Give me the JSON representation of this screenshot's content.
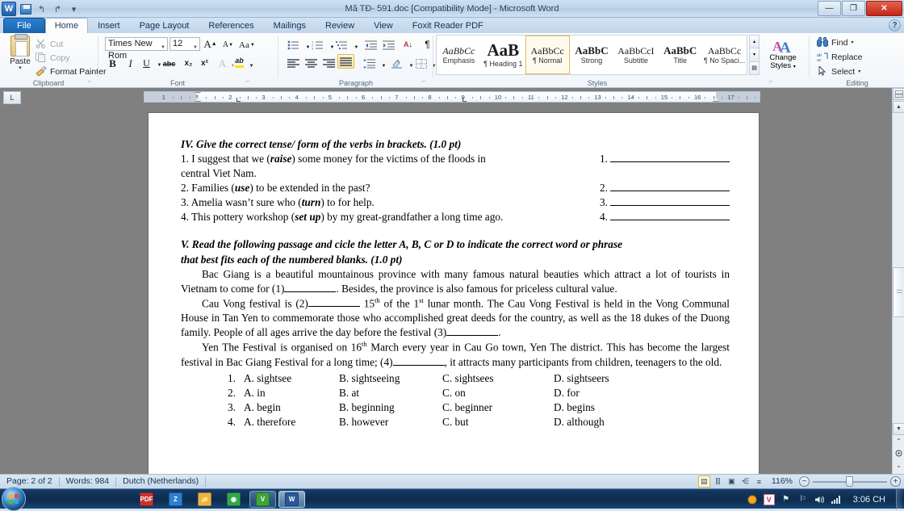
{
  "window": {
    "title": "Mã TĐ- 591.doc [Compatibility Mode]  -  Microsoft Word",
    "minimize": "—",
    "maximize": "❐",
    "close": "✕",
    "help": "?"
  },
  "quick_access": {
    "app_icon_label": "W",
    "save_label": "",
    "undo_label": "↰",
    "redo_label": "↱",
    "customize_label": "▾"
  },
  "ribbon": {
    "tabs": [
      {
        "label": "File",
        "state": "file"
      },
      {
        "label": "Home",
        "state": "active"
      },
      {
        "label": "Insert",
        "state": ""
      },
      {
        "label": "Page Layout",
        "state": ""
      },
      {
        "label": "References",
        "state": ""
      },
      {
        "label": "Mailings",
        "state": ""
      },
      {
        "label": "Review",
        "state": ""
      },
      {
        "label": "View",
        "state": ""
      },
      {
        "label": "Foxit Reader PDF",
        "state": ""
      }
    ],
    "clipboard": {
      "group_label": "Clipboard",
      "paste_label": "Paste",
      "paste_arrow": "▾",
      "cut_label": "Cut",
      "copy_label": "Copy",
      "format_painter_label": "Format Painter"
    },
    "font": {
      "group_label": "Font",
      "font_name": "Times New Rom",
      "font_size": "12",
      "grow_font": "A",
      "shrink_font": "A",
      "change_case": "Aa",
      "clear_formatting": "⌫",
      "bold": "B",
      "italic": "I",
      "underline": "U",
      "strikethrough": "abc",
      "subscript": "x₂",
      "superscript": "x²",
      "text_effects": "A",
      "highlight": "ab",
      "font_color": "A"
    },
    "paragraph": {
      "group_label": "Paragraph",
      "bullets": "≔",
      "numbering": "≔",
      "multilevel": "≔",
      "decrease_indent": "⇤",
      "increase_indent": "⇥",
      "sort": "A↓",
      "show_marks": "¶",
      "align_left": "≡",
      "align_center": "≡",
      "align_right": "≡",
      "justify": "≡",
      "line_spacing": "↕",
      "shading": "▨",
      "borders": "⊞"
    },
    "styles": {
      "group_label": "Styles",
      "items": [
        {
          "preview": "AaBbCc",
          "name": "Emphasis",
          "selected": false,
          "style": "italic"
        },
        {
          "preview": "AaB",
          "name": "¶ Heading 1",
          "selected": false,
          "style": "h1"
        },
        {
          "preview": "AaBbCc",
          "name": "¶ Normal",
          "selected": true,
          "style": "normal"
        },
        {
          "preview": "AaBbC",
          "name": "Strong",
          "selected": false,
          "style": "bold"
        },
        {
          "preview": "AaBbCcI",
          "name": "Subtitle",
          "selected": false,
          "style": "normal"
        },
        {
          "preview": "AaBbC",
          "name": "Title",
          "selected": false,
          "style": "bold"
        },
        {
          "preview": "AaBbCc",
          "name": "¶ No Spaci...",
          "selected": false,
          "style": "normal"
        }
      ],
      "change_styles_label": "Change\nStyles",
      "change_styles_line1": "Change",
      "change_styles_line2": "Styles",
      "change_styles_arrow": "▾",
      "gallery_up": "▴",
      "gallery_down": "▾",
      "gallery_more": "▤"
    },
    "editing": {
      "group_label": "Editing",
      "find_label": "Find",
      "find_arrow": "▾",
      "replace_label": "Replace",
      "select_label": "Select",
      "select_arrow": "▾"
    }
  },
  "ruler": {
    "corner_label": "L",
    "numbers": [
      "1",
      "1",
      "1",
      "2",
      "3",
      "4",
      "5",
      "6",
      "7",
      "8",
      "9",
      "10",
      "11",
      "12",
      "13",
      "14",
      "15",
      "16",
      "17"
    ]
  },
  "document": {
    "section4": {
      "heading": "IV. Give the correct tense/ form of the verbs in brackets. (1.0 pt)",
      "items": [
        {
          "number": "1.",
          "text_before": "1. I suggest that we (",
          "verb": "raise",
          "text_after": ") some money for the victims of the floods in",
          "line2": "central Viet Nam.",
          "answer_number": "1."
        },
        {
          "number": "2.",
          "text_before": "2. Families (",
          "verb": "use",
          "text_after": ") to be extended in the past?",
          "answer_number": "2."
        },
        {
          "number": "3.",
          "text_before": "3. Amelia wasn’t sure who (",
          "verb": "turn",
          "text_after": ") to for help.",
          "answer_number": "3."
        },
        {
          "number": "4.",
          "text_before": "4. This pottery workshop (",
          "verb": "set up",
          "text_after": ") by my great-grandfather a long time ago.",
          "answer_number": "4."
        }
      ]
    },
    "section5": {
      "heading_line1": "V. Read the following passage and cicle the letter A, B, C or D to indicate the correct word or phrase",
      "heading_line2": "that best fits each of the numbered blanks. (1.0 pt)",
      "para1_a": "Bac Giang is a beautiful mountainous province with many famous natural beauties which attract a lot of tourists in Vietnam to come for (1)",
      "para1_b": ". Besides, the province is also famous for priceless cultural value.",
      "para2_a": "Cau Vong festival is (2)",
      "para2_b": " 15",
      "para2_sup1": "th",
      "para2_c": " of the 1",
      "para2_sup2": "st",
      "para2_d": " lunar month. The Cau Vong Festival is held in the Vong Communal House in Tan Yen to commemorate those who accomplished great deeds for the country, as well as the 18 dukes of the Duong family. People of all ages arrive the day before the festival (3)",
      "para2_e": ".",
      "para3_a": "Yen The Festival is organised on 16",
      "para3_sup": "th",
      "para3_b": " March every year in Cau Go town, Yen The district. This has become the largest festival in Bac Giang Festival for a long time; (4)",
      "para3_c": ", it attracts many participants from children, teenagers to the old.",
      "options": [
        {
          "n": "1.",
          "a": "A. sightsee",
          "b": "B. sightseeing",
          "c": "C. sightsees",
          "d": "D. sightseers"
        },
        {
          "n": "2.",
          "a": "A. in",
          "b": "B. at",
          "c": "C. on",
          "d": "D. for"
        },
        {
          "n": "3.",
          "a": "A. begin",
          "b": "B. beginning",
          "c": "C. beginner",
          "d": "D. begins"
        },
        {
          "n": "4.",
          "a": "A. therefore",
          "b": "B. however",
          "c": "C. but",
          "d": "D. although"
        }
      ]
    }
  },
  "statusbar": {
    "page": "Page: 2 of 2",
    "words": "Words: 984",
    "language": "Dutch (Netherlands)",
    "zoom_level": "116%",
    "zoom_out": "−",
    "zoom_in": "+",
    "view_buttons": [
      {
        "name": "print-layout",
        "glyph": "▤",
        "selected": true
      },
      {
        "name": "full-screen-reading",
        "glyph": "⫿⫿",
        "selected": false
      },
      {
        "name": "web-layout",
        "glyph": "▣",
        "selected": false
      },
      {
        "name": "outline",
        "glyph": "⋲",
        "selected": false
      },
      {
        "name": "draft",
        "glyph": "≡",
        "selected": false
      }
    ]
  },
  "scrollbar": {
    "up_arrow": "▲",
    "down_arrow": "▼",
    "previous_page": "⌃",
    "select_browse_object": "●",
    "next_page": "⌄"
  },
  "taskbar": {
    "start_label": "",
    "items": [
      {
        "name": "taskbar-item-pdf",
        "glyph": "PDF",
        "state": ""
      },
      {
        "name": "taskbar-item-zalo",
        "glyph": "Z",
        "state": ""
      },
      {
        "name": "taskbar-item-explorer",
        "glyph": "📁",
        "state": ""
      },
      {
        "name": "taskbar-item-chrome",
        "glyph": "◉",
        "state": ""
      },
      {
        "name": "taskbar-item-unikey",
        "glyph": "V",
        "state": "run"
      },
      {
        "name": "taskbar-item-word",
        "glyph": "W",
        "state": "active"
      }
    ],
    "tray": {
      "unikey": "V",
      "flag": "⚑",
      "action_center": "⚐",
      "volume": "🔊",
      "network": "▂▄▆",
      "clock": "3:06 CH"
    }
  },
  "colors": {
    "accent": "#1f5fa8",
    "page_bg": "#808080",
    "taskbar": "#0d2b4d",
    "style_selected_border": "#e3b94a"
  }
}
